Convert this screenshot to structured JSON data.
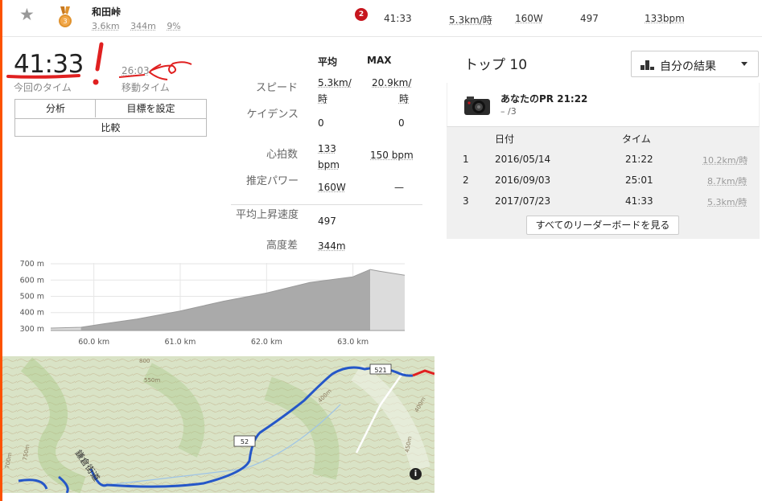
{
  "segment_row": {
    "name": "和田峠",
    "distance": "3.6km",
    "elevation": "344m",
    "grade": "9%",
    "medal_rank": "3",
    "badge_count": "2",
    "time": "41:33",
    "speed": "5.3km/時",
    "power": "160W",
    "value": "497",
    "heart_rate": "133bpm"
  },
  "summary": {
    "elapsed_time": "41:33",
    "elapsed_label": "今回のタイム",
    "moving_time": "26:03",
    "moving_label": "移動タイム",
    "analysis_button": "分析",
    "goal_button": "目標を設定",
    "compare_button": "比較"
  },
  "stats": {
    "header_avg": "平均",
    "header_max": "MAX",
    "rows": [
      {
        "label": "スピード",
        "avg": "5.3km/時",
        "max": "20.9km/時"
      },
      {
        "label": "ケイデンス",
        "avg": "0",
        "max": "0"
      },
      {
        "label": "心拍数",
        "avg": "133 bpm",
        "max": "150 bpm"
      },
      {
        "label": "推定パワー",
        "avg": "160W",
        "max": "—"
      }
    ],
    "vam_label": "平均上昇速度",
    "vam_value": "497",
    "elev_label": "高度差",
    "elev_value": "344m"
  },
  "chart_data": {
    "type": "area",
    "x": [
      59.5,
      59.85,
      60.1,
      60.5,
      61.0,
      61.5,
      62.0,
      62.5,
      63.0,
      63.2,
      63.3,
      63.6
    ],
    "y": [
      305,
      310,
      330,
      360,
      410,
      470,
      520,
      585,
      620,
      665,
      655,
      630
    ],
    "xticks": [
      "60.0 km",
      "61.0 km",
      "62.0 km",
      "63.0 km"
    ],
    "xtick_values": [
      60.0,
      61.0,
      62.0,
      63.0
    ],
    "yticks": [
      "300 m",
      "400 m",
      "500 m",
      "600 m",
      "700 m"
    ],
    "ytick_values": [
      300,
      400,
      500,
      600,
      700
    ],
    "xlim": [
      59.5,
      63.6
    ],
    "ylim": [
      290,
      705
    ],
    "segment_range": [
      59.85,
      63.2
    ],
    "colors": {
      "segment": "#aaaaaa",
      "outside": "#dcdcdc",
      "line": "#9a9a9a"
    }
  },
  "map": {
    "route_labels": [
      "521",
      "52",
      "鎌倉街道"
    ],
    "contour_labels": [
      "800",
      "550m",
      "400m",
      "400m",
      "450m",
      "700m",
      "750m"
    ],
    "info_label": "i"
  },
  "leaderboard": {
    "title": "トップ 10",
    "filter_label": "自分の結果",
    "pr_title": "あなたのPR 21:22",
    "pr_sub": "– /3",
    "col_date": "日付",
    "col_time": "タイム",
    "rows": [
      {
        "rank": "1",
        "date": "2016/05/14",
        "time": "21:22",
        "speed": "10.2km/時"
      },
      {
        "rank": "2",
        "date": "2016/09/03",
        "time": "25:01",
        "speed": "8.7km/時"
      },
      {
        "rank": "3",
        "date": "2017/07/23",
        "time": "41:33",
        "speed": "5.3km/時"
      }
    ],
    "see_all": "すべてのリーダーボードを見る"
  },
  "colors": {
    "accent": "#fc5200",
    "badge": "#c7161e",
    "route": "#1e4fc4",
    "annotation": "#e02020"
  }
}
